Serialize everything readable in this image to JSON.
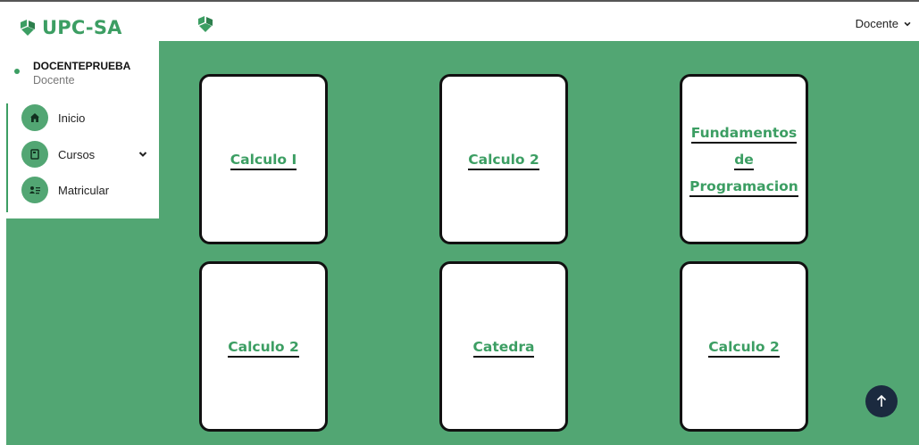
{
  "brand": {
    "name": "UPC-SA",
    "logo_icon": "upc-logo-icon",
    "color": "#3c9e63"
  },
  "user": {
    "name": "DOCENTEPRUEBA",
    "role": "Docente"
  },
  "sidebar": {
    "items": [
      {
        "label": "Inicio",
        "icon": "home-icon"
      },
      {
        "label": "Cursos",
        "icon": "book-icon",
        "expandable": true
      },
      {
        "label": "Matricular",
        "icon": "id-card-icon"
      }
    ]
  },
  "topbar": {
    "user_menu_label": "Docente"
  },
  "courses": [
    {
      "title": "Calculo I"
    },
    {
      "title": "Calculo 2"
    },
    {
      "title": "Fundamentos de Programacion"
    },
    {
      "title": "Calculo 2"
    },
    {
      "title": "Catedra"
    },
    {
      "title": "Calculo 2"
    }
  ],
  "colors": {
    "accent": "#52a673",
    "text_accent": "#3c9e63",
    "scroll_button": "#1b2a3f"
  }
}
